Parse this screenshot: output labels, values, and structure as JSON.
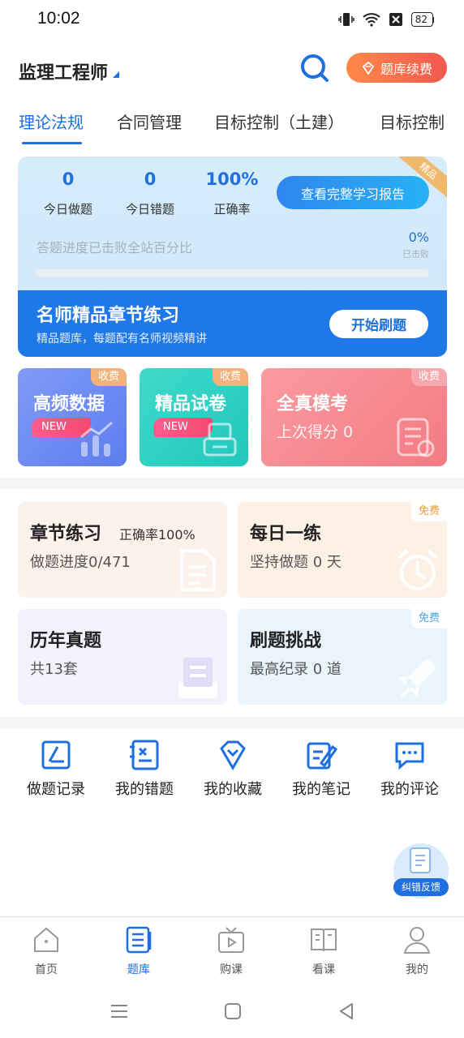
{
  "status": {
    "time": "10:02",
    "battery": "82"
  },
  "header": {
    "title": "监理工程师",
    "renew_label": "题库续费"
  },
  "tabs": [
    {
      "label": "理论法规",
      "active": true
    },
    {
      "label": "合同管理",
      "active": false
    },
    {
      "label": "目标控制（土建）",
      "active": false
    },
    {
      "label": "目标控制",
      "active": false
    }
  ],
  "stats": {
    "items": [
      {
        "value": "0",
        "label": "今日做题"
      },
      {
        "value": "0",
        "label": "今日错题"
      },
      {
        "value": "100%",
        "label": "正确率"
      }
    ],
    "report_button": "查看完整学习报告",
    "progress_label": "答题进度已击败全站百分比",
    "progress_value": "0%",
    "progress_sub": "已击败",
    "progress_fraction": 0
  },
  "promo": {
    "title": "名师精品章节练习",
    "subtitle": "精品题库，每题配有名师视频精讲",
    "button": "开始刷题",
    "ribbon": "精品"
  },
  "tiles": [
    {
      "title": "高频数据",
      "tag": "收费",
      "badge": "NEW",
      "color_from": "#7f9bf5",
      "color_to": "#5d7df0"
    },
    {
      "title": "精品试卷",
      "tag": "收费",
      "badge": "NEW",
      "color_from": "#3fdacb",
      "color_to": "#22c7bd"
    },
    {
      "title": "全真模考",
      "tag": "收费",
      "subtitle": "上次得分 0",
      "color_from": "#fa9aa0",
      "color_to": "#f37b84"
    }
  ],
  "grid": [
    {
      "title": "章节练习",
      "extra": "正确率100%",
      "subtitle": "做题进度0/471",
      "bg": "#fdf1ec"
    },
    {
      "title": "每日一练",
      "subtitle": "坚持做题 0 天",
      "tag": "免费",
      "bg": "#fdf1e6"
    },
    {
      "title": "历年真题",
      "subtitle": "共13套",
      "bg": "#f4f1fd"
    },
    {
      "title": "刷题挑战",
      "subtitle": "最高纪录 0 道",
      "tag": "免费",
      "bg": "#e9f4fd"
    }
  ],
  "shortcuts": [
    {
      "label": "做题记录",
      "icon": "record-icon"
    },
    {
      "label": "我的错题",
      "icon": "wrong-icon"
    },
    {
      "label": "我的收藏",
      "icon": "favorite-icon"
    },
    {
      "label": "我的笔记",
      "icon": "note-icon"
    },
    {
      "label": "我的评论",
      "icon": "comment-icon"
    }
  ],
  "feedback_label": "纠错反馈",
  "bottom_nav": [
    {
      "label": "首页",
      "icon": "home-icon"
    },
    {
      "label": "题库",
      "icon": "question-bank-icon",
      "active": true
    },
    {
      "label": "购课",
      "icon": "tv-icon"
    },
    {
      "label": "看课",
      "icon": "book-icon"
    },
    {
      "label": "我的",
      "icon": "profile-icon"
    }
  ],
  "colors": {
    "accent": "#1e6fe0",
    "renew": "#f2584e"
  }
}
